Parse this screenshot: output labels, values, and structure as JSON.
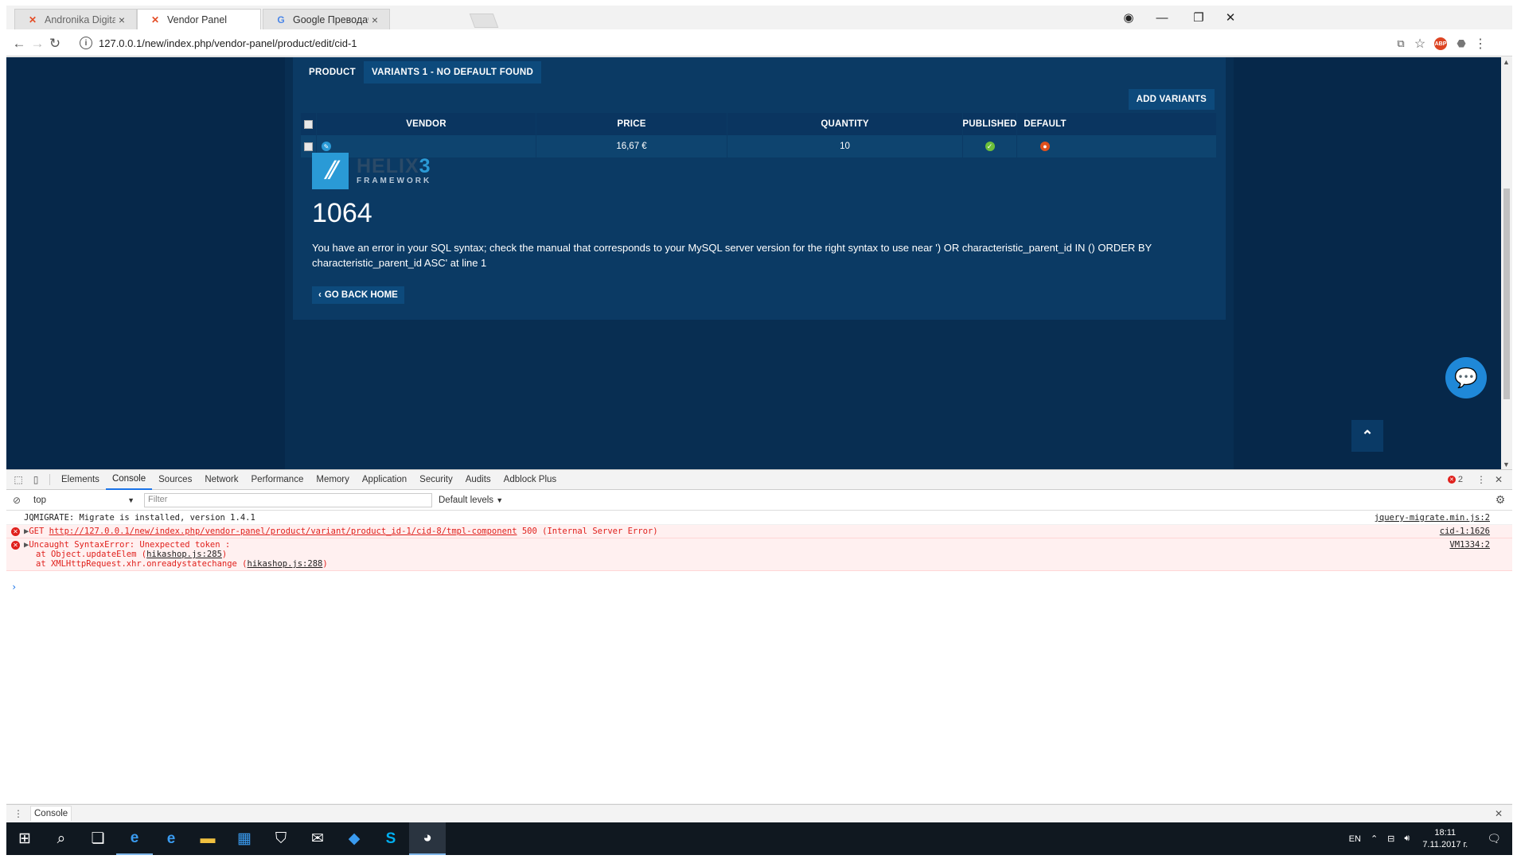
{
  "browser": {
    "tabs": [
      {
        "title": "Andronika Digital Ltd - A",
        "icon": "joomla-icon",
        "active": false
      },
      {
        "title": "Vendor Panel",
        "icon": "joomla-icon",
        "active": true
      },
      {
        "title": "Google Преводач",
        "icon": "google-translate-icon",
        "active": false
      }
    ],
    "url": "127.0.0.1/new/index.php/vendor-panel/product/edit/cid-1"
  },
  "page": {
    "tabs": [
      "PRODUCT",
      "VARIANTS 1 - NO DEFAULT FOUND"
    ],
    "add_variants": "ADD VARIANTS",
    "table": {
      "headers": {
        "vendor": "VENDOR",
        "price": "PRICE",
        "quantity": "QUANTITY",
        "published": "PUBLISHED",
        "default": "DEFAULT"
      },
      "rows": [
        {
          "vendor": "",
          "price": "16,67 €",
          "quantity": "10",
          "published": "yes",
          "default": "no"
        }
      ]
    },
    "logo": {
      "word": "HELIX",
      "number": "3",
      "sub": "FRAMEWORK"
    },
    "error_code": "1064",
    "error_message": "You have an error in your SQL syntax; check the manual that corresponds to your MySQL server version for the right syntax to use near ') OR characteristic_parent_id IN () ORDER BY characteristic_parent_id ASC' at line 1",
    "go_back_home": "GO BACK HOME"
  },
  "devtools": {
    "tabs": [
      "Elements",
      "Console",
      "Sources",
      "Network",
      "Performance",
      "Memory",
      "Application",
      "Security",
      "Audits",
      "Adblock Plus"
    ],
    "active_tab": "Console",
    "error_count": "2",
    "context": "top",
    "filter_placeholder": "Filter",
    "levels": "Default levels",
    "console": [
      {
        "type": "log",
        "text": "JQMIGRATE: Migrate is installed, version 1.4.1",
        "source": "jquery-migrate.min.js:2"
      },
      {
        "type": "error",
        "prefix": "GET ",
        "link": "http://127.0.0.1/new/index.php/vendor-panel/product/variant/product_id-1/cid-8/tmpl-component",
        "suffix": " 500 (Internal Server Error)",
        "source": "cid-1:1626"
      },
      {
        "type": "error",
        "text": "Uncaught SyntaxError: Unexpected token :",
        "stack": [
          {
            "pre": "at Object.updateElem (",
            "link": "hikashop.js:285",
            "post": ")"
          },
          {
            "pre": "at XMLHttpRequest.xhr.onreadystatechange (",
            "link": "hikashop.js:288",
            "post": ")"
          }
        ],
        "source": "VM1334:2"
      }
    ],
    "drawer_tab": "Console"
  },
  "taskbar": {
    "language": "EN",
    "time": "18:11",
    "date": "7.11.2017 г."
  },
  "colors": {
    "page_bg": "#06284a",
    "panel_bg": "#0b3a64",
    "accent": "#2a9ad6",
    "error_red": "#e0201c"
  }
}
